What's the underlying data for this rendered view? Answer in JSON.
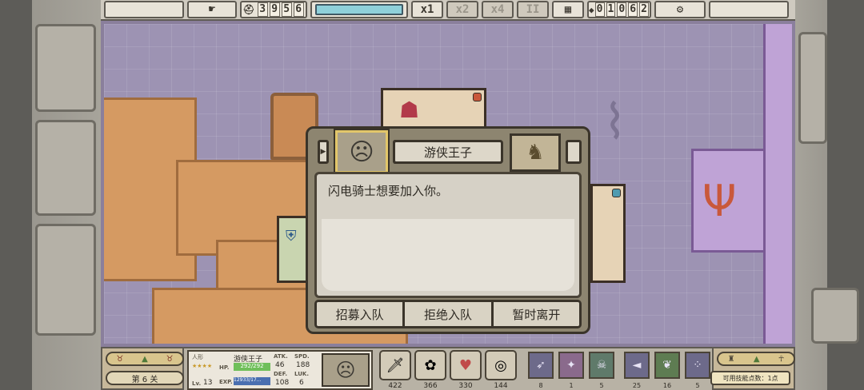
{
  "topbar": {
    "timer_digits": [
      "3",
      "9",
      "5",
      "6"
    ],
    "speed_options": [
      "x1",
      "x2",
      "x4"
    ],
    "pause_label": "II",
    "gold_digits": [
      "0",
      "1",
      "0",
      "6",
      "2"
    ],
    "icons": {
      "hand": "pointing-hand-icon",
      "helmet": "viking-helmet-icon",
      "crystal": "gold-coin-icon",
      "settings": "gear-icon",
      "map": "map-icon"
    }
  },
  "dialog": {
    "hero_name": "游侠王子",
    "message": "闪电骑士想要加入你。",
    "buttons": [
      "招募入队",
      "拒绝入队",
      "暂时离开"
    ]
  },
  "bottom": {
    "level_label": "第 6 关",
    "hero": {
      "class_label": "人形",
      "name": "游侠王子",
      "hp_label": "HP.",
      "hp_value": "292/292",
      "exp_label": "EXP.",
      "exp_value": "12933/17...",
      "lv_label": "Lv.",
      "lv_value": "13",
      "atk_label": "ATK.",
      "atk_value": "46",
      "spd_label": "SPD.",
      "spd_value": "188",
      "def_label": "DEF.",
      "def_value": "108",
      "luk_label": "LUK.",
      "luk_value": "6"
    },
    "skills": [
      {
        "icon": "sword-icon",
        "value": "422"
      },
      {
        "icon": "rose-icon",
        "value": "366"
      },
      {
        "icon": "heart-icon",
        "value": "330"
      },
      {
        "icon": "medal-icon",
        "value": "144"
      }
    ],
    "items": [
      {
        "icon": "bow-icon",
        "value": "8"
      },
      {
        "icon": "shuriken-icon",
        "value": "1"
      },
      {
        "icon": "mask-icon",
        "value": "5"
      },
      {
        "icon": "arrow-icon",
        "value": "25"
      },
      {
        "icon": "leaf-icon",
        "value": "16"
      },
      {
        "icon": "dice-icon",
        "value": "5"
      }
    ],
    "skill_points": "可用技能点数：1点"
  },
  "colors": {
    "map_purple": "#9d93b3",
    "sand": "#d59a62",
    "violet": "#bfa3d6",
    "dialog_frame": "#8d8570"
  }
}
